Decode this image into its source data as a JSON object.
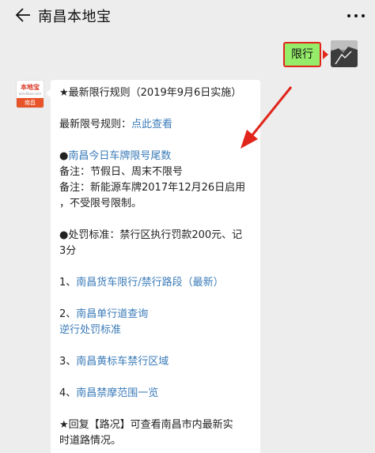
{
  "header": {
    "title": "南昌本地宝"
  },
  "sent_message": {
    "text": "限行"
  },
  "bot_avatar": {
    "logo_text": "本地宝",
    "logo_sub": "bendibao.com",
    "band_text": "南昌"
  },
  "message": {
    "line1": "★最新限行规则（2019年9月6日实施）",
    "line2_prefix": "最新限号规则：",
    "line2_link": "点此查看",
    "line3_prefix": "●",
    "line3_link": "南昌今日车牌限号尾数",
    "line4": "备注：节假日、周末不限号",
    "line5": "备注：新能源车牌2017年12月26日启用",
    "line6": "，不受限号限制。",
    "line7": "●处罚标准：禁行区执行罚款200元、记",
    "line8": "3分",
    "item1_prefix": "1、",
    "item1_link": "南昌货车限行/禁行路段（最新）",
    "item2_prefix": "2、",
    "item2_link": "南昌单行道查询",
    "item2_link2": "逆行处罚标准",
    "item3_prefix": "3、",
    "item3_link": "南昌黄标车禁行区域",
    "item4_prefix": "4、",
    "item4_link": "南昌禁摩范围一览",
    "footer1": "★回复【路况】可查看南昌市内最新实",
    "footer2": "时道路情况。"
  },
  "colors": {
    "link": "#3a7bb8",
    "sent_bubble": "#95ec69",
    "highlight": "#e1251b"
  }
}
